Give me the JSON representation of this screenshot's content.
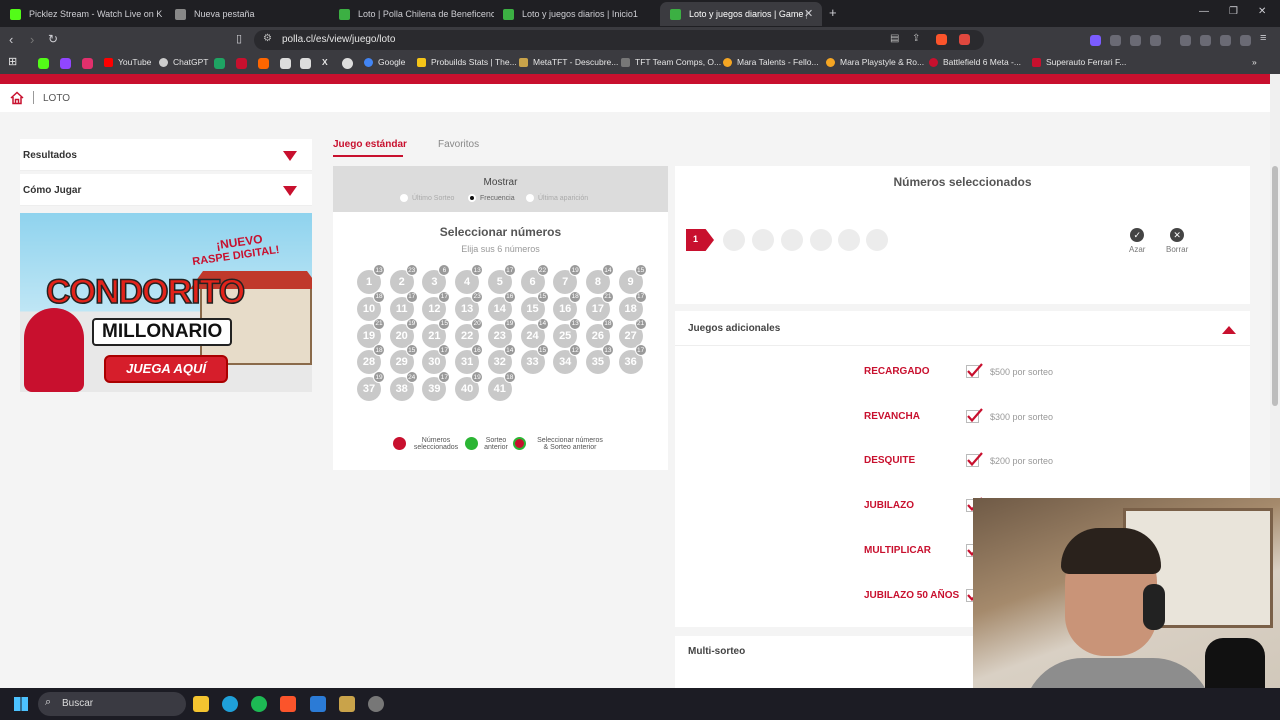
{
  "browser": {
    "tabs": [
      {
        "label": "Picklez Stream - Watch Live on K",
        "icon_color": "#53fc18"
      },
      {
        "label": "Nueva pestaña",
        "icon_color": "#888888"
      },
      {
        "label": "Loto | Polla Chilena de Beneficencia",
        "icon_color": "#3cb043"
      },
      {
        "label": "Loto y juegos diarios | Inicio1",
        "icon_color": "#3cb043"
      },
      {
        "label": "Loto y juegos diarios | Game | LO",
        "icon_color": "#3cb043"
      }
    ],
    "new_tab": "+",
    "url": "polla.cl/es/view/juego/loto",
    "bookmarks": [
      "YouTube",
      "ChatGPT",
      "Google",
      "Probuilds Stats | The...",
      "MetaTFT - Descubre...",
      "TFT Team Comps, O...",
      "Mara Talents - Fello...",
      "Mara Playstyle & Ro...",
      "Battlefield 6 Meta -...",
      "Superauto Ferrari F..."
    ]
  },
  "page": {
    "breadcrumb": "LOTO",
    "sidebar": {
      "items": [
        "Resultados",
        "Cómo Jugar"
      ],
      "banner": {
        "line1": "¡NUEVO",
        "line2": "RASPE DIGITAL!",
        "title1": "CONDORITO",
        "title2": "MILLONARIO",
        "cta": "JUEGA AQUÍ"
      }
    },
    "game_tabs": [
      "Juego estándar",
      "Favoritos"
    ],
    "show": {
      "title": "Mostrar",
      "options": [
        "Último Sorteo",
        "Frecuencia",
        "Última aparición"
      ],
      "selected": "Frecuencia"
    },
    "select": {
      "title": "Seleccionar números",
      "subtitle": "Elija sus 6 números"
    },
    "numbers": [
      {
        "n": "1",
        "f": "13"
      },
      {
        "n": "2",
        "f": "23"
      },
      {
        "n": "3",
        "f": "6"
      },
      {
        "n": "4",
        "f": "13"
      },
      {
        "n": "5",
        "f": "17"
      },
      {
        "n": "6",
        "f": "22"
      },
      {
        "n": "7",
        "f": "19"
      },
      {
        "n": "8",
        "f": "14"
      },
      {
        "n": "9",
        "f": "15"
      },
      {
        "n": "10",
        "f": "18"
      },
      {
        "n": "11",
        "f": "17"
      },
      {
        "n": "12",
        "f": "17"
      },
      {
        "n": "13",
        "f": "23"
      },
      {
        "n": "14",
        "f": "16"
      },
      {
        "n": "15",
        "f": "15"
      },
      {
        "n": "16",
        "f": "18"
      },
      {
        "n": "17",
        "f": "21"
      },
      {
        "n": "18",
        "f": "17"
      },
      {
        "n": "19",
        "f": "21"
      },
      {
        "n": "20",
        "f": "19"
      },
      {
        "n": "21",
        "f": "15"
      },
      {
        "n": "22",
        "f": "20"
      },
      {
        "n": "23",
        "f": "19"
      },
      {
        "n": "24",
        "f": "14"
      },
      {
        "n": "25",
        "f": "13"
      },
      {
        "n": "26",
        "f": "18"
      },
      {
        "n": "27",
        "f": "21"
      },
      {
        "n": "28",
        "f": "18"
      },
      {
        "n": "29",
        "f": "15"
      },
      {
        "n": "30",
        "f": "17"
      },
      {
        "n": "31",
        "f": "16"
      },
      {
        "n": "32",
        "f": "14"
      },
      {
        "n": "33",
        "f": "15"
      },
      {
        "n": "34",
        "f": "12"
      },
      {
        "n": "35",
        "f": "13"
      },
      {
        "n": "36",
        "f": "17"
      },
      {
        "n": "37",
        "f": "19"
      },
      {
        "n": "38",
        "f": "24"
      },
      {
        "n": "39",
        "f": "17"
      },
      {
        "n": "40",
        "f": "19"
      },
      {
        "n": "41",
        "f": "18"
      }
    ],
    "legend": [
      {
        "label1": "Números",
        "label2": "seleccionados",
        "color": "#c8102e"
      },
      {
        "label1": "Sorteo",
        "label2": "anterior",
        "color": "#2bb534"
      },
      {
        "label1": "Seleccionar números",
        "label2": "& Sorteo anterior",
        "color": "#c8102e",
        "ring": "#2bb534"
      }
    ],
    "selected_panel": {
      "title": "Números seleccionados",
      "counter": "1",
      "random": "Azar",
      "clear": "Borrar"
    },
    "additional": {
      "title": "Juegos adicionales",
      "games": [
        {
          "name": "RECARGADO",
          "price": "$500 por sorteo"
        },
        {
          "name": "REVANCHA",
          "price": "$300 por sorteo"
        },
        {
          "name": "DESQUITE",
          "price": "$200 por sorteo"
        },
        {
          "name": "JUBILAZO",
          "price": ""
        },
        {
          "name": "MULTIPLICAR",
          "price": ""
        },
        {
          "name": "JUBILAZO 50 AÑOS",
          "price": ""
        }
      ]
    },
    "multi": {
      "title": "Multi-sorteo"
    }
  },
  "taskbar": {
    "search": "Buscar"
  },
  "colors": {
    "brand_red": "#c8102e"
  }
}
